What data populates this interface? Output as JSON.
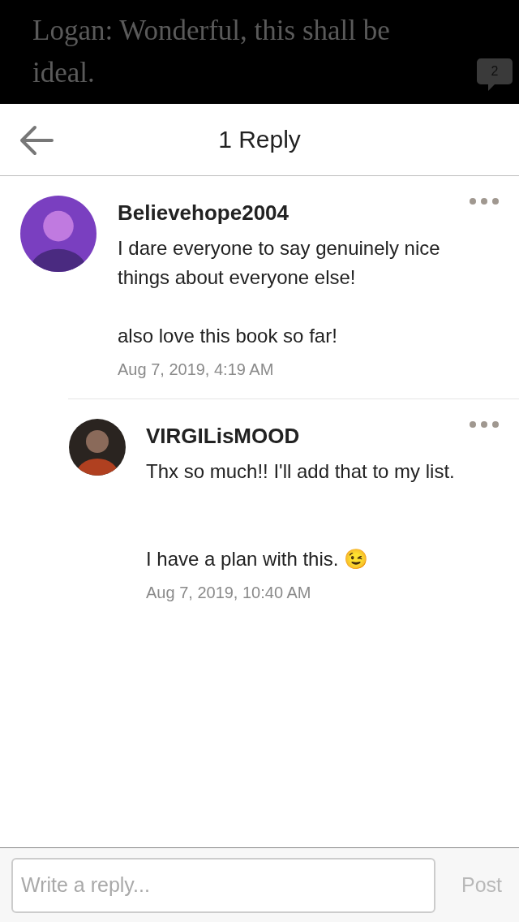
{
  "story_paragraph": {
    "text": "Logan: Wonderful, this shall be ideal.",
    "comment_count": "2"
  },
  "header": {
    "title": "1 Reply"
  },
  "comment": {
    "author": "Believehope2004",
    "text": "I dare everyone to say genuinely nice things about everyone else!\n\nalso love this book so far!",
    "time": "Aug 7, 2019, 4:19 AM"
  },
  "replies": [
    {
      "author": "VIRGILisMOOD",
      "text": "Thx so much!! I'll add that to my list.\n\n\nI have a plan with this. 😉",
      "time": "Aug 7, 2019, 10:40 AM"
    }
  ],
  "composer": {
    "placeholder": "Write a reply...",
    "post": {
      "label": "Post",
      "disabled": true
    }
  }
}
